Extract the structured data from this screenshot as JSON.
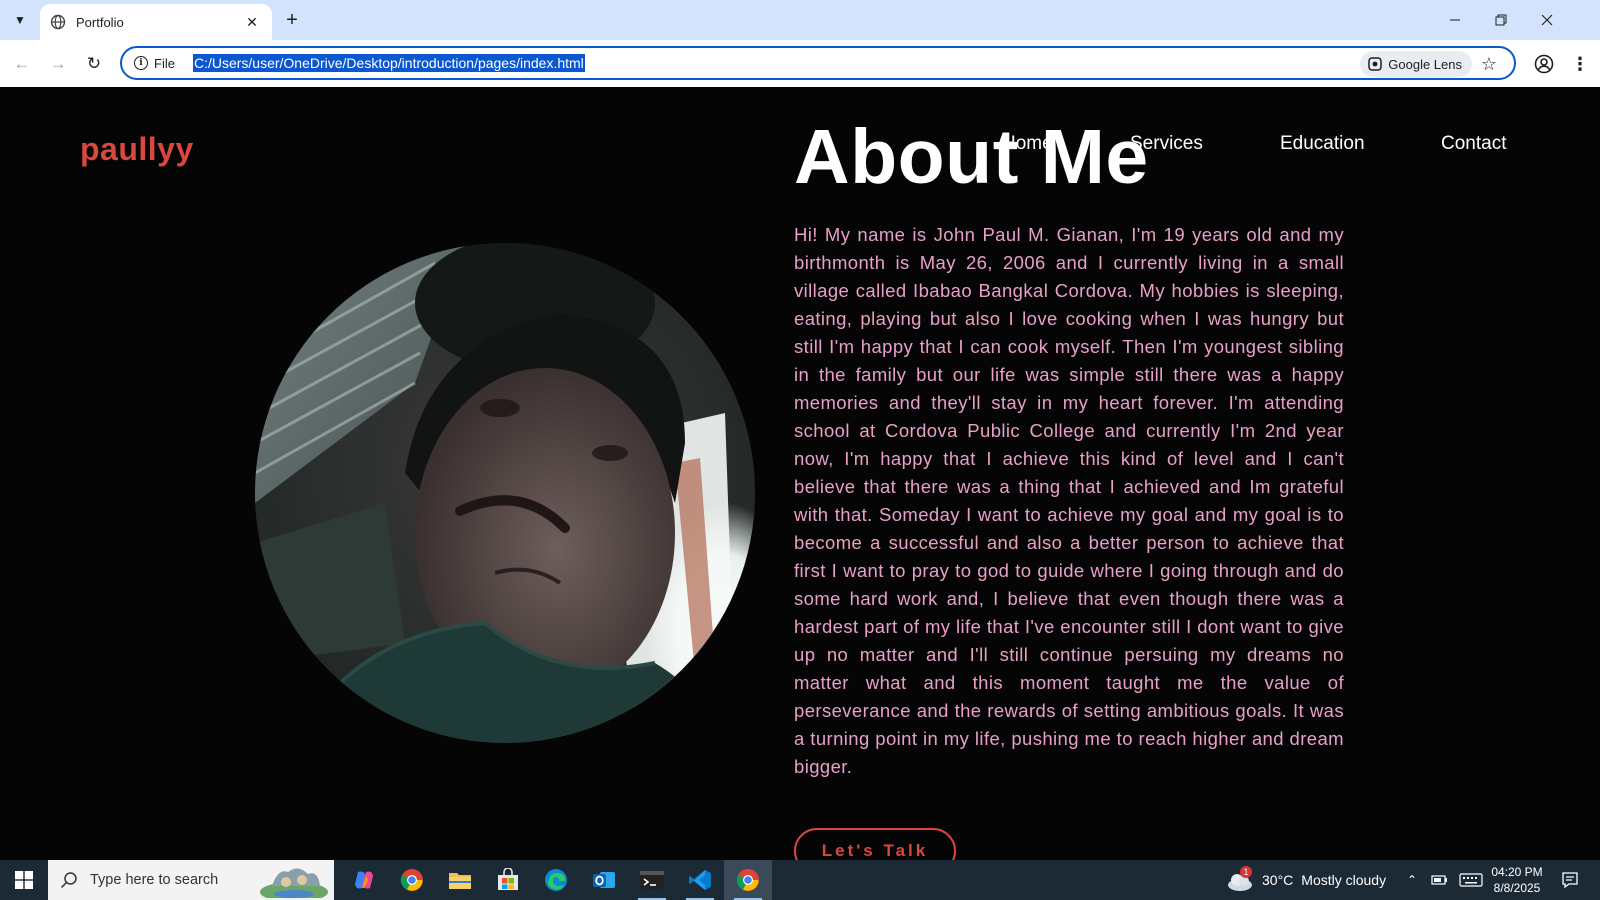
{
  "browser": {
    "tab_title": "Portfolio",
    "new_tab_symbol": "+",
    "site_info_label": "File",
    "url": "C:/Users/user/OneDrive/Desktop/introduction/pages/index.html",
    "lens_label": "Google Lens"
  },
  "site": {
    "logo": "paullyy",
    "nav": [
      "Home",
      "Services",
      "Education",
      "Contact"
    ],
    "about_title": "About Me",
    "about_text": "Hi! My name is John Paul M. Gianan, I'm 19 years old and my birthmonth is May 26, 2006 and I currently living in a small village called Ibabao Bangkal Cordova. My hobbies is sleeping, eating, playing but also I love cooking when I was hungry but still I'm happy that I can cook myself. Then I'm youngest sibling in the family but our life was simple still there was a happy memories and they'll stay in my heart forever. I'm attending school at Cordova Public College and currently I'm 2nd year now, I'm happy that I achieve this kind of level and I can't believe that there was a thing that I achieved and Im grateful with that. Someday I want to achieve my goal and my goal is to become a successful and also a better person to achieve that first I want to pray to god to guide where I going through and do some hard work and, I believe that even though there was a hardest part of my life that I've encounter still I dont want to give up no matter and I'll still continue persuing my dreams no matter what and this moment taught me the value of perseverance and the rewards of setting ambitious goals. It was a turning point in my life, pushing me to reach higher and dream bigger.",
    "cta_label": "Let's Talk"
  },
  "colors": {
    "accent": "#d9473f",
    "text_pink": "#e8a0c8",
    "background": "#050505"
  },
  "taskbar": {
    "search_placeholder": "Type here to search",
    "apps": [
      "copilot-icon",
      "chrome-icon",
      "file-explorer-icon",
      "microsoft-store-icon",
      "edge-icon",
      "outlook-icon",
      "terminal-icon",
      "vscode-icon",
      "chrome-icon"
    ],
    "weather_badge": "1",
    "weather_temp": "30°C",
    "weather_desc": "Mostly cloudy",
    "time": "04:20 PM",
    "date": "8/8/2025"
  }
}
